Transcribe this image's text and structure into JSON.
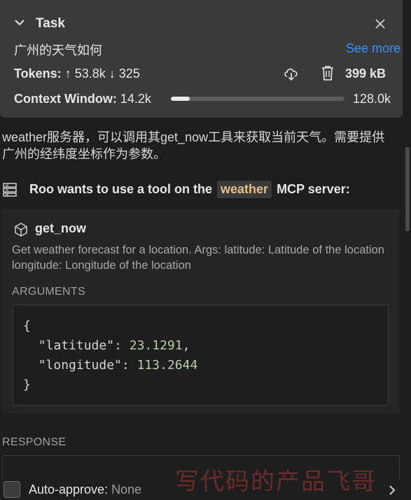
{
  "task": {
    "title": "Task",
    "text": "广州的天气如何",
    "see_more": "See more",
    "tokens_label": "Tokens:",
    "tokens_in": "53.8k",
    "tokens_out": "325",
    "size": "399 kB",
    "context_label": "Context Window:",
    "context_used": "14.2k",
    "context_max": "128.0k",
    "context_fraction": 0.11
  },
  "message": "weather服务器，可以调用其get_now工具来获取当前天气。需要提供广州的经纬度坐标作为参数。",
  "tool_request": {
    "prefix": "Roo wants to use a tool on the",
    "server": "weather",
    "suffix": "MCP server:"
  },
  "tool": {
    "name": "get_now",
    "description": "Get weather forecast for a location. Args: latitude: Latitude of the location longitude: Longitude of the location",
    "args_label": "ARGUMENTS",
    "args": {
      "latitude_key": "\"latitude\"",
      "latitude_val": "23.1291",
      "longitude_key": "\"longitude\"",
      "longitude_val": "113.2644"
    }
  },
  "response_label": "RESPONSE",
  "footer": {
    "auto_approve_label": "Auto-approve:",
    "auto_approve_value": "None"
  },
  "watermark": "写代码的产品飞哥",
  "icons": {
    "chevron": "chevron-down-icon",
    "close": "close-icon",
    "cloud": "cloud-download-icon",
    "trash": "trash-icon",
    "server": "server-icon",
    "cube": "cube-icon",
    "chevron_right": "chevron-right-icon"
  },
  "colors": {
    "accent_link": "#3794ff",
    "server_badge": "#e2c08d",
    "json_number": "#b5cea8"
  }
}
